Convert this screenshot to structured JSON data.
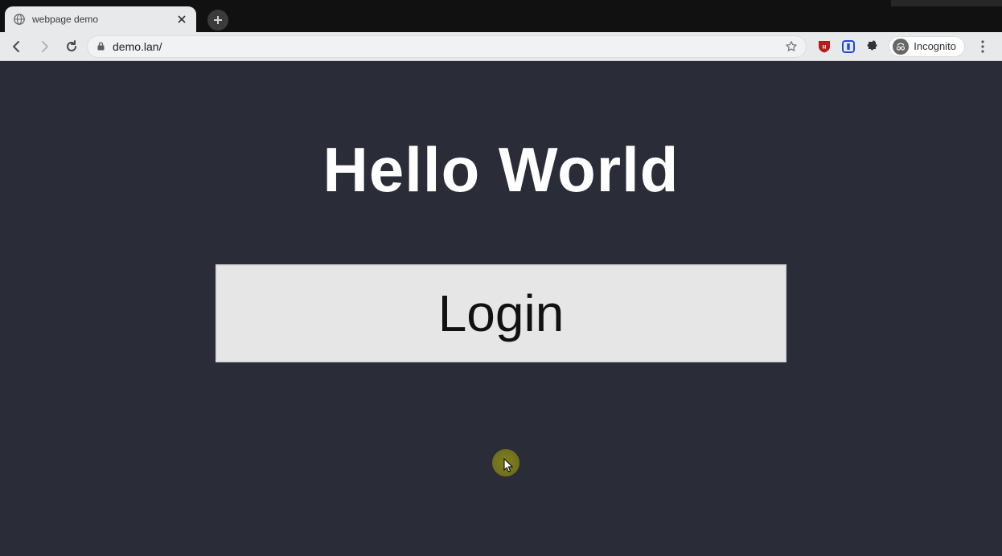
{
  "browser": {
    "tab": {
      "title": "webpage demo"
    },
    "url": "demo.lan/",
    "incognito_label": "Incognito"
  },
  "page": {
    "heading": "Hello World",
    "login_label": "Login"
  }
}
